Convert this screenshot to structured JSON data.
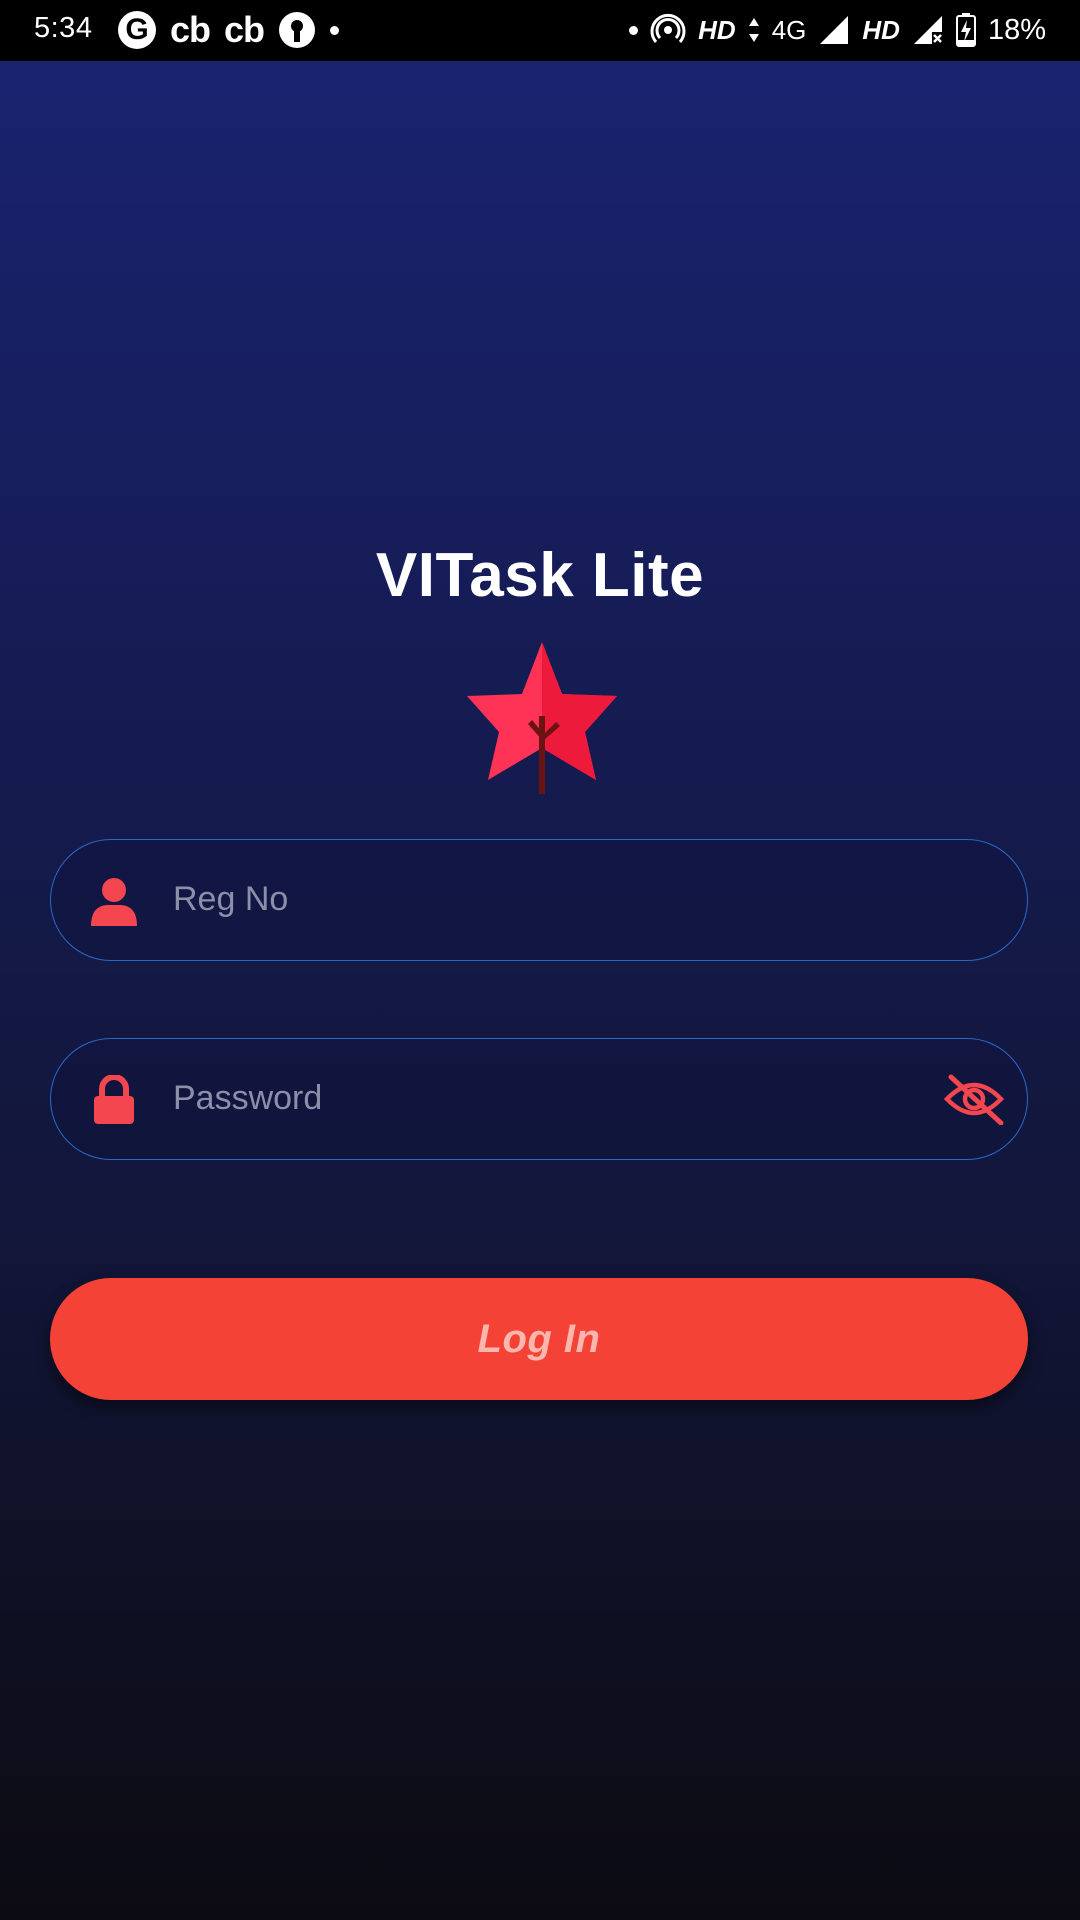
{
  "status_bar": {
    "time": "5:34",
    "left_icons": [
      "google-icon",
      "cb-icon",
      "cb-icon",
      "keyhole-icon",
      "notification-dot"
    ],
    "cb_label": "cb",
    "g_label": "G",
    "hd1": "HD",
    "net": "4G",
    "hd2": "HD",
    "battery": "18%",
    "right_icons": [
      "notification-dot",
      "hotspot-icon",
      "data-arrows-icon",
      "signal-icon",
      "signal-x-icon",
      "battery-charging-icon"
    ]
  },
  "app": {
    "title": "VITask Lite",
    "logo": "maple-leaf-icon"
  },
  "form": {
    "reg_no": {
      "value": "",
      "placeholder": "Reg No",
      "icon": "user-icon"
    },
    "password": {
      "value": "",
      "placeholder": "Password",
      "icon": "lock-icon",
      "toggle_icon": "eye-off-icon"
    },
    "login_label": "Log In"
  },
  "colors": {
    "accent": "#f44336",
    "icon_red": "#f4464f",
    "field_border": "#2a68c8",
    "bg_top": "#19236f",
    "bg_bottom": "#0c0b12"
  }
}
